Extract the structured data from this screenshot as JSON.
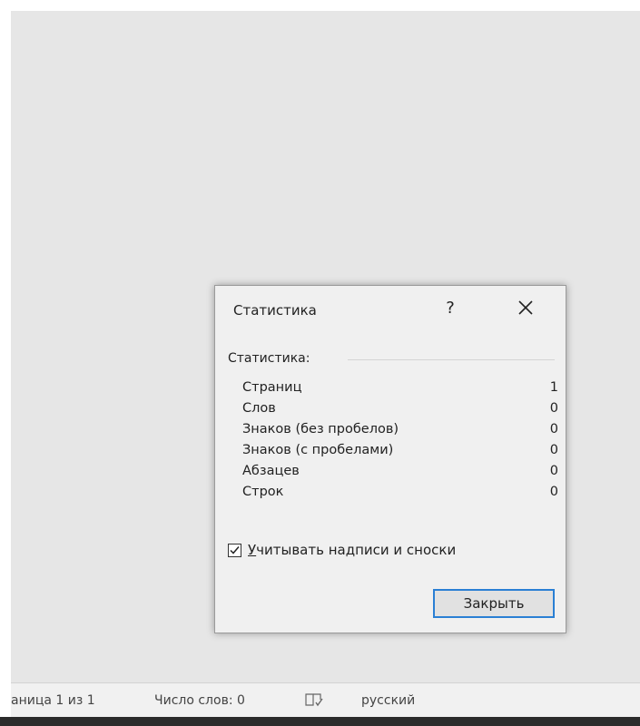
{
  "status_bar": {
    "page": "аница 1 из 1",
    "words": "Число слов: 0",
    "proofing_icon": "proofing-book-icon",
    "language": "русский"
  },
  "dialog": {
    "title": "Статистика",
    "help": "?",
    "close_icon": "close-icon",
    "group_label": "Статистика:",
    "stats": [
      {
        "label": "Страниц",
        "value": "1"
      },
      {
        "label": "Слов",
        "value": "0"
      },
      {
        "label": "Знаков (без пробелов)",
        "value": "0"
      },
      {
        "label": "Знаков (с пробелами)",
        "value": "0"
      },
      {
        "label": "Абзацев",
        "value": "0"
      },
      {
        "label": "Строк",
        "value": "0"
      }
    ],
    "checkbox": {
      "accel": "У",
      "label_rest": "читывать надписи и сноски",
      "checked": true
    },
    "close_button": "Закрыть"
  },
  "colors": {
    "accent": "#2a7fd4",
    "background": "#e6e6e6",
    "dialog_bg": "#f0f0f0"
  }
}
